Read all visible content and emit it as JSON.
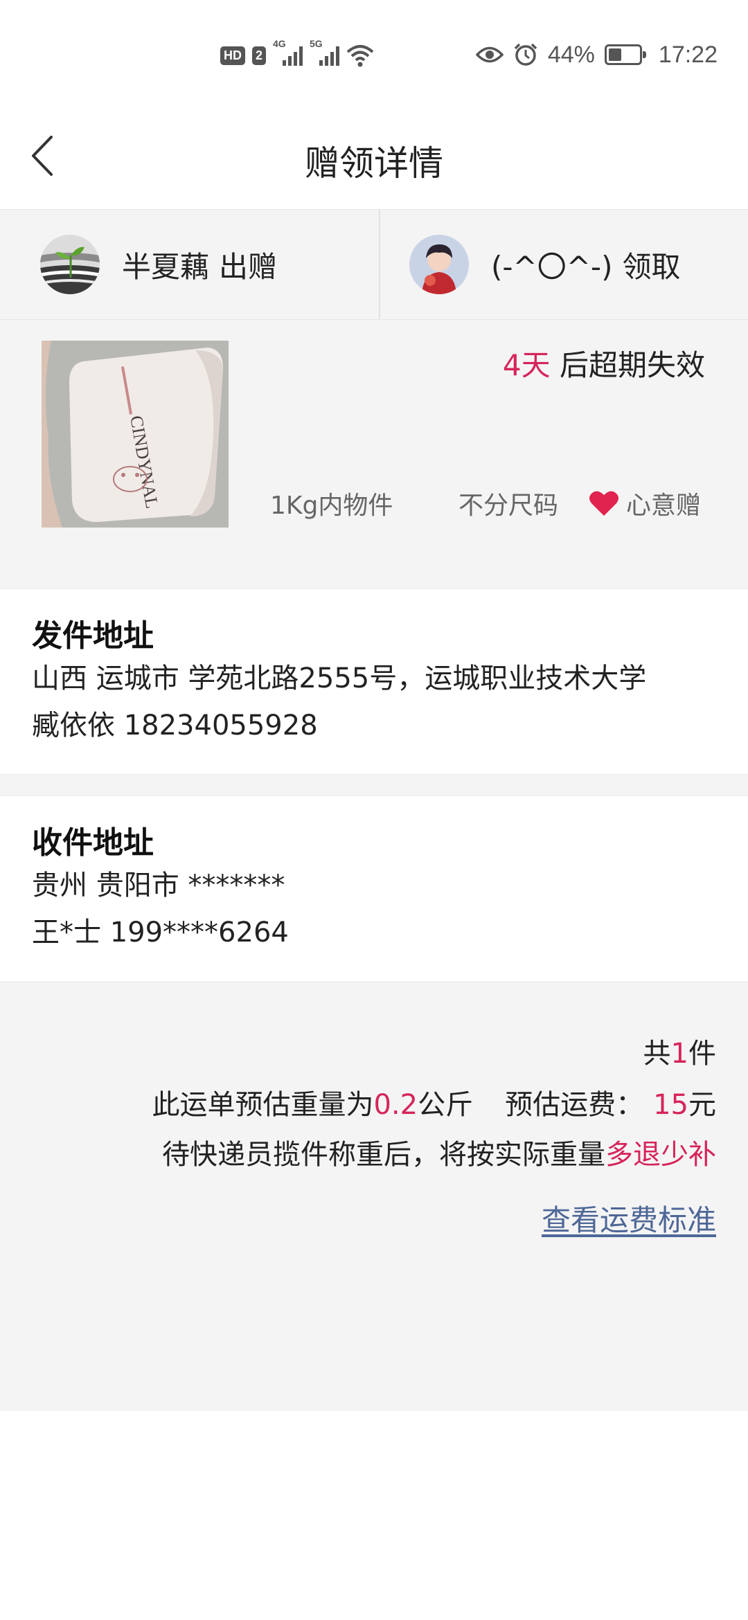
{
  "status_bar": {
    "hd_badge": "HD",
    "sim_badge": "2",
    "sig1_label": "4G",
    "sig2_label": "5G",
    "battery_pct": "44%",
    "battery_level": 0.44,
    "time": "17:22"
  },
  "header": {
    "title": "赠领详情"
  },
  "participants": {
    "giver": {
      "name": "半夏藕",
      "action": "出赠"
    },
    "receiver": {
      "name": "(-^〇^-)",
      "action": "领取"
    }
  },
  "gift": {
    "expiry_days": "4天",
    "expiry_suffix": " 后超期失效",
    "tag_weight": "1Kg内物件",
    "tag_size": "不分尺码",
    "tag_type": "心意赠",
    "photo_brand_text": "CINDYNAL"
  },
  "sender_address": {
    "title": "发件地址",
    "line1": "山西 运城市 学苑北路2555号，运城职业技术大学",
    "line2": "臧依依 18234055928"
  },
  "receiver_address": {
    "title": "收件地址",
    "line1": "贵州 贵阳市 *******",
    "line2": "王*士 199****6264"
  },
  "summary": {
    "count_prefix": "共",
    "count": "1",
    "count_suffix": "件",
    "weight_prefix": "此运单预估重量为",
    "weight": "0.2",
    "weight_unit": "公斤",
    "fee_label": "预估运费：",
    "fee": "15",
    "fee_unit": "元",
    "note_prefix": "待快递员揽件称重后，将按实际重量",
    "note_highlight": "多退少补",
    "fee_link": "查看运费标准"
  },
  "colors": {
    "accent_red": "#d6245a",
    "link_blue": "#4e6797",
    "panel_gray": "#f4f4f4"
  }
}
